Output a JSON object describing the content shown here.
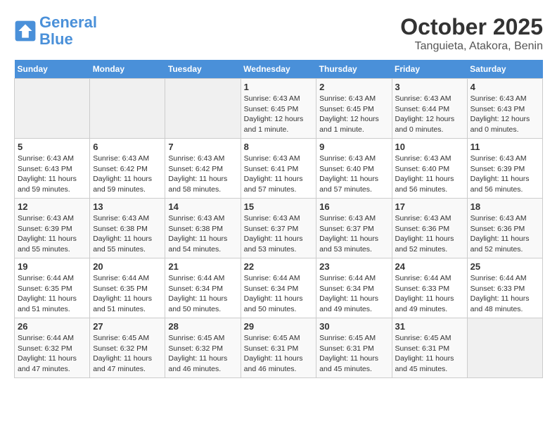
{
  "logo": {
    "line1": "General",
    "line2": "Blue"
  },
  "title": "October 2025",
  "subtitle": "Tanguieta, Atakora, Benin",
  "days_of_week": [
    "Sunday",
    "Monday",
    "Tuesday",
    "Wednesday",
    "Thursday",
    "Friday",
    "Saturday"
  ],
  "weeks": [
    [
      {
        "day": "",
        "info": ""
      },
      {
        "day": "",
        "info": ""
      },
      {
        "day": "",
        "info": ""
      },
      {
        "day": "1",
        "info": "Sunrise: 6:43 AM\nSunset: 6:45 PM\nDaylight: 12 hours\nand 1 minute."
      },
      {
        "day": "2",
        "info": "Sunrise: 6:43 AM\nSunset: 6:45 PM\nDaylight: 12 hours\nand 1 minute."
      },
      {
        "day": "3",
        "info": "Sunrise: 6:43 AM\nSunset: 6:44 PM\nDaylight: 12 hours\nand 0 minutes."
      },
      {
        "day": "4",
        "info": "Sunrise: 6:43 AM\nSunset: 6:43 PM\nDaylight: 12 hours\nand 0 minutes."
      }
    ],
    [
      {
        "day": "5",
        "info": "Sunrise: 6:43 AM\nSunset: 6:43 PM\nDaylight: 11 hours\nand 59 minutes."
      },
      {
        "day": "6",
        "info": "Sunrise: 6:43 AM\nSunset: 6:42 PM\nDaylight: 11 hours\nand 59 minutes."
      },
      {
        "day": "7",
        "info": "Sunrise: 6:43 AM\nSunset: 6:42 PM\nDaylight: 11 hours\nand 58 minutes."
      },
      {
        "day": "8",
        "info": "Sunrise: 6:43 AM\nSunset: 6:41 PM\nDaylight: 11 hours\nand 57 minutes."
      },
      {
        "day": "9",
        "info": "Sunrise: 6:43 AM\nSunset: 6:40 PM\nDaylight: 11 hours\nand 57 minutes."
      },
      {
        "day": "10",
        "info": "Sunrise: 6:43 AM\nSunset: 6:40 PM\nDaylight: 11 hours\nand 56 minutes."
      },
      {
        "day": "11",
        "info": "Sunrise: 6:43 AM\nSunset: 6:39 PM\nDaylight: 11 hours\nand 56 minutes."
      }
    ],
    [
      {
        "day": "12",
        "info": "Sunrise: 6:43 AM\nSunset: 6:39 PM\nDaylight: 11 hours\nand 55 minutes."
      },
      {
        "day": "13",
        "info": "Sunrise: 6:43 AM\nSunset: 6:38 PM\nDaylight: 11 hours\nand 55 minutes."
      },
      {
        "day": "14",
        "info": "Sunrise: 6:43 AM\nSunset: 6:38 PM\nDaylight: 11 hours\nand 54 minutes."
      },
      {
        "day": "15",
        "info": "Sunrise: 6:43 AM\nSunset: 6:37 PM\nDaylight: 11 hours\nand 53 minutes."
      },
      {
        "day": "16",
        "info": "Sunrise: 6:43 AM\nSunset: 6:37 PM\nDaylight: 11 hours\nand 53 minutes."
      },
      {
        "day": "17",
        "info": "Sunrise: 6:43 AM\nSunset: 6:36 PM\nDaylight: 11 hours\nand 52 minutes."
      },
      {
        "day": "18",
        "info": "Sunrise: 6:43 AM\nSunset: 6:36 PM\nDaylight: 11 hours\nand 52 minutes."
      }
    ],
    [
      {
        "day": "19",
        "info": "Sunrise: 6:44 AM\nSunset: 6:35 PM\nDaylight: 11 hours\nand 51 minutes."
      },
      {
        "day": "20",
        "info": "Sunrise: 6:44 AM\nSunset: 6:35 PM\nDaylight: 11 hours\nand 51 minutes."
      },
      {
        "day": "21",
        "info": "Sunrise: 6:44 AM\nSunset: 6:34 PM\nDaylight: 11 hours\nand 50 minutes."
      },
      {
        "day": "22",
        "info": "Sunrise: 6:44 AM\nSunset: 6:34 PM\nDaylight: 11 hours\nand 50 minutes."
      },
      {
        "day": "23",
        "info": "Sunrise: 6:44 AM\nSunset: 6:34 PM\nDaylight: 11 hours\nand 49 minutes."
      },
      {
        "day": "24",
        "info": "Sunrise: 6:44 AM\nSunset: 6:33 PM\nDaylight: 11 hours\nand 49 minutes."
      },
      {
        "day": "25",
        "info": "Sunrise: 6:44 AM\nSunset: 6:33 PM\nDaylight: 11 hours\nand 48 minutes."
      }
    ],
    [
      {
        "day": "26",
        "info": "Sunrise: 6:44 AM\nSunset: 6:32 PM\nDaylight: 11 hours\nand 47 minutes."
      },
      {
        "day": "27",
        "info": "Sunrise: 6:45 AM\nSunset: 6:32 PM\nDaylight: 11 hours\nand 47 minutes."
      },
      {
        "day": "28",
        "info": "Sunrise: 6:45 AM\nSunset: 6:32 PM\nDaylight: 11 hours\nand 46 minutes."
      },
      {
        "day": "29",
        "info": "Sunrise: 6:45 AM\nSunset: 6:31 PM\nDaylight: 11 hours\nand 46 minutes."
      },
      {
        "day": "30",
        "info": "Sunrise: 6:45 AM\nSunset: 6:31 PM\nDaylight: 11 hours\nand 45 minutes."
      },
      {
        "day": "31",
        "info": "Sunrise: 6:45 AM\nSunset: 6:31 PM\nDaylight: 11 hours\nand 45 minutes."
      },
      {
        "day": "",
        "info": ""
      }
    ]
  ]
}
